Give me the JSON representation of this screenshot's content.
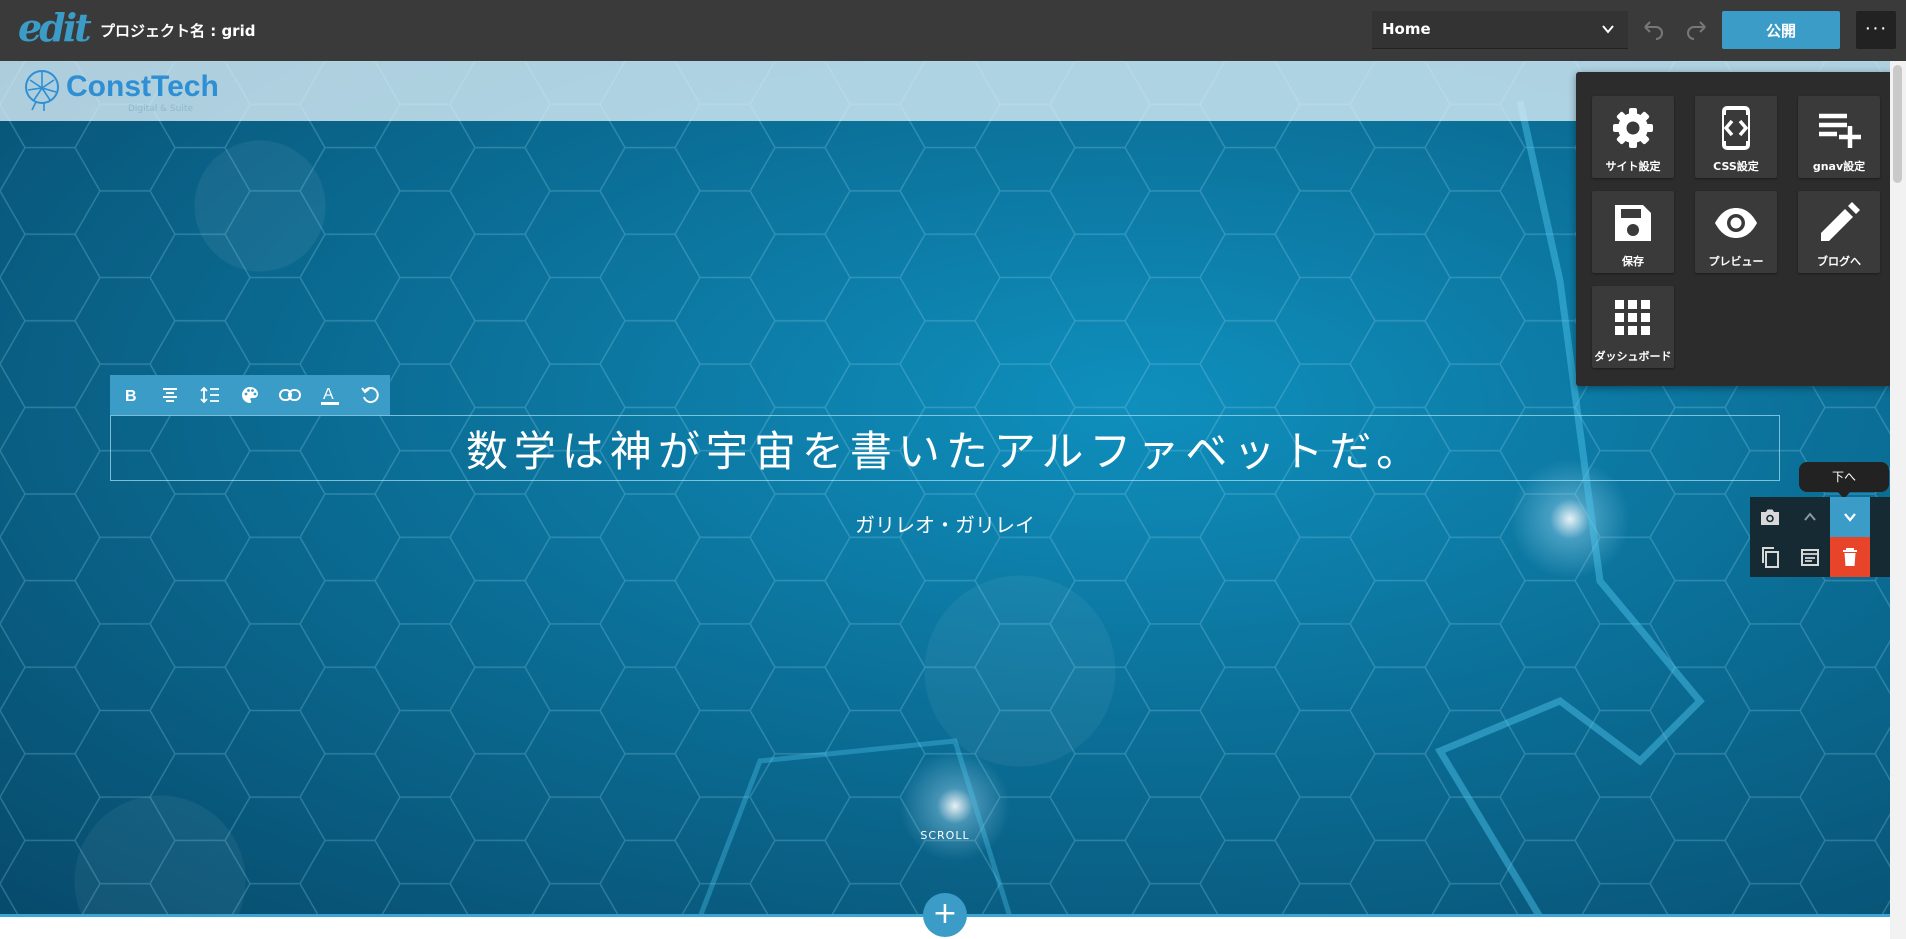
{
  "app": {
    "logo_text": "edit",
    "project_label": "プロジェクト名 : grid"
  },
  "toolbar": {
    "page_select_value": "Home",
    "undo_icon": "undo-icon",
    "redo_icon": "redo-icon",
    "publish_label": "公開",
    "more_icon": "more-horizontal-icon"
  },
  "site": {
    "brand_name": "ConstTech",
    "brand_tagline": "Digital & Suite"
  },
  "hero": {
    "heading": "数学は神が宇宙を書いたアルファベットだ。",
    "attribution": "ガリレオ・ガリレイ",
    "scroll_label": "SCROLL"
  },
  "editor_toolbar": {
    "buttons": [
      "bold-icon",
      "align-center-icon",
      "line-spacing-icon",
      "palette-icon",
      "link-icon",
      "text-color-icon",
      "reset-icon"
    ]
  },
  "block_controls": {
    "tooltip": "下へ",
    "buttons": [
      "camera-icon",
      "move-up-icon",
      "move-down-icon",
      "copy-icon",
      "edit-block-icon",
      "delete-icon"
    ]
  },
  "menu": {
    "items": [
      {
        "label": "サイト設定",
        "icon": "gear-icon"
      },
      {
        "label": "CSS設定",
        "icon": "code-device-icon"
      },
      {
        "label": "gnav設定",
        "icon": "playlist-add-icon"
      },
      {
        "label": "保存",
        "icon": "save-icon"
      },
      {
        "label": "プレビュー",
        "icon": "eye-icon"
      },
      {
        "label": "ブログへ",
        "icon": "pencil-icon"
      },
      {
        "label": "ダッシュボード",
        "icon": "grid-icon"
      }
    ]
  },
  "colors": {
    "topbar": "#3a3a3a",
    "accent": "#3b9cc8",
    "danger": "#e8442a",
    "menu_bg": "#2c2c2c",
    "hero_bg": "#0b6f97"
  }
}
